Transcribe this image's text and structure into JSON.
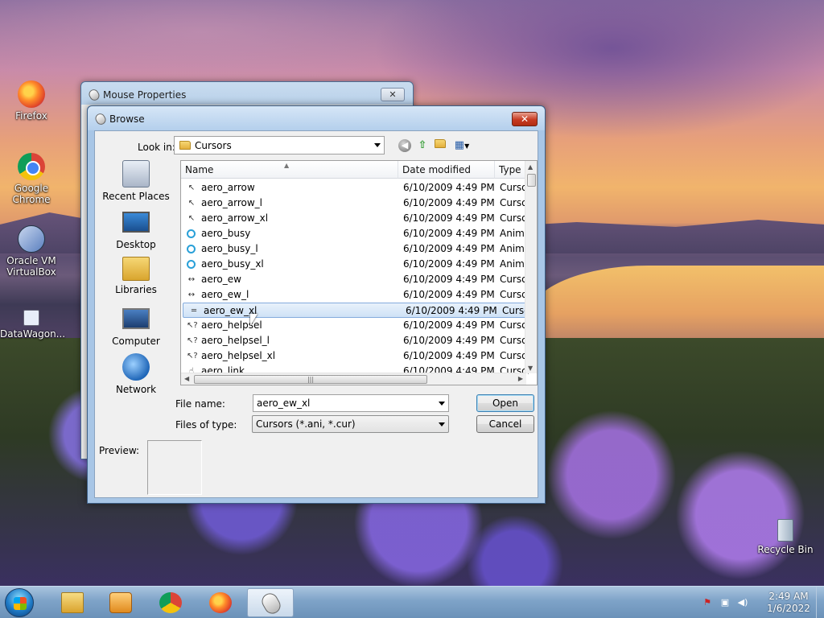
{
  "desktop": {
    "icons": [
      {
        "label": "Firefox",
        "icon": "firefox-icon"
      },
      {
        "label": "Google Chrome",
        "icon": "chrome-icon"
      },
      {
        "label": "Oracle VM VirtualBox",
        "icon": "virtualbox-icon"
      },
      {
        "label": "DataWagon...",
        "icon": "shortcut-icon"
      },
      {
        "label": "Recycle Bin",
        "icon": "recycle-bin-icon"
      }
    ]
  },
  "mouse_window": {
    "title": "Mouse Properties",
    "close_label": "✕"
  },
  "browse": {
    "title": "Browse",
    "close_label": "✕",
    "look_in_label": "Look in:",
    "look_in_value": "Cursors",
    "places": [
      {
        "label": "Recent Places",
        "icon": "recent-places-icon"
      },
      {
        "label": "Desktop",
        "icon": "desktop-icon"
      },
      {
        "label": "Libraries",
        "icon": "libraries-icon"
      },
      {
        "label": "Computer",
        "icon": "computer-icon"
      },
      {
        "label": "Network",
        "icon": "network-icon"
      }
    ],
    "columns": {
      "name": "Name",
      "date": "Date modified",
      "type": "Type"
    },
    "files": [
      {
        "name": "aero_arrow",
        "date": "6/10/2009 4:49 PM",
        "type": "Cursor",
        "icon": "arrow",
        "glyph": "↖"
      },
      {
        "name": "aero_arrow_l",
        "date": "6/10/2009 4:49 PM",
        "type": "Cursor",
        "icon": "arrow",
        "glyph": "↖"
      },
      {
        "name": "aero_arrow_xl",
        "date": "6/10/2009 4:49 PM",
        "type": "Cursor",
        "icon": "arrow",
        "glyph": "↖"
      },
      {
        "name": "aero_busy",
        "date": "6/10/2009 4:49 PM",
        "type": "Animated",
        "icon": "busy",
        "glyph": ""
      },
      {
        "name": "aero_busy_l",
        "date": "6/10/2009 4:49 PM",
        "type": "Animated",
        "icon": "busy",
        "glyph": ""
      },
      {
        "name": "aero_busy_xl",
        "date": "6/10/2009 4:49 PM",
        "type": "Animated",
        "icon": "busy",
        "glyph": ""
      },
      {
        "name": "aero_ew",
        "date": "6/10/2009 4:49 PM",
        "type": "Cursor",
        "icon": "ew",
        "glyph": "↔"
      },
      {
        "name": "aero_ew_l",
        "date": "6/10/2009 4:49 PM",
        "type": "Cursor",
        "icon": "ew",
        "glyph": "↔"
      },
      {
        "name": "aero_ew_xl",
        "date": "6/10/2009 4:49 PM",
        "type": "Cursor",
        "icon": "ew",
        "glyph": "═",
        "selected": true
      },
      {
        "name": "aero_helpsel",
        "date": "6/10/2009 4:49 PM",
        "type": "Cursor",
        "icon": "help",
        "glyph": "↖?"
      },
      {
        "name": "aero_helpsel_l",
        "date": "6/10/2009 4:49 PM",
        "type": "Cursor",
        "icon": "help",
        "glyph": "↖?"
      },
      {
        "name": "aero_helpsel_xl",
        "date": "6/10/2009 4:49 PM",
        "type": "Cursor",
        "icon": "help",
        "glyph": "↖?"
      },
      {
        "name": "aero_link",
        "date": "6/10/2009 4:49 PM",
        "type": "Cursor",
        "icon": "link",
        "glyph": "☝"
      }
    ],
    "file_name_label": "File name:",
    "file_name_value": "aero_ew_xl",
    "file_type_label": "Files of type:",
    "file_type_value": "Cursors (*.ani, *.cur)",
    "open_label": "Open",
    "cancel_label": "Cancel",
    "preview_label": "Preview:"
  },
  "taskbar": {
    "items": [
      {
        "name": "explorer",
        "icon": "explorer-icon"
      },
      {
        "name": "media-player",
        "icon": "media-player-icon"
      },
      {
        "name": "chrome",
        "icon": "chrome-icon"
      },
      {
        "name": "firefox",
        "icon": "firefox-icon"
      },
      {
        "name": "mouse-properties",
        "icon": "mouse-icon",
        "active": true
      }
    ],
    "time": "2:49 AM",
    "date": "1/6/2022"
  }
}
